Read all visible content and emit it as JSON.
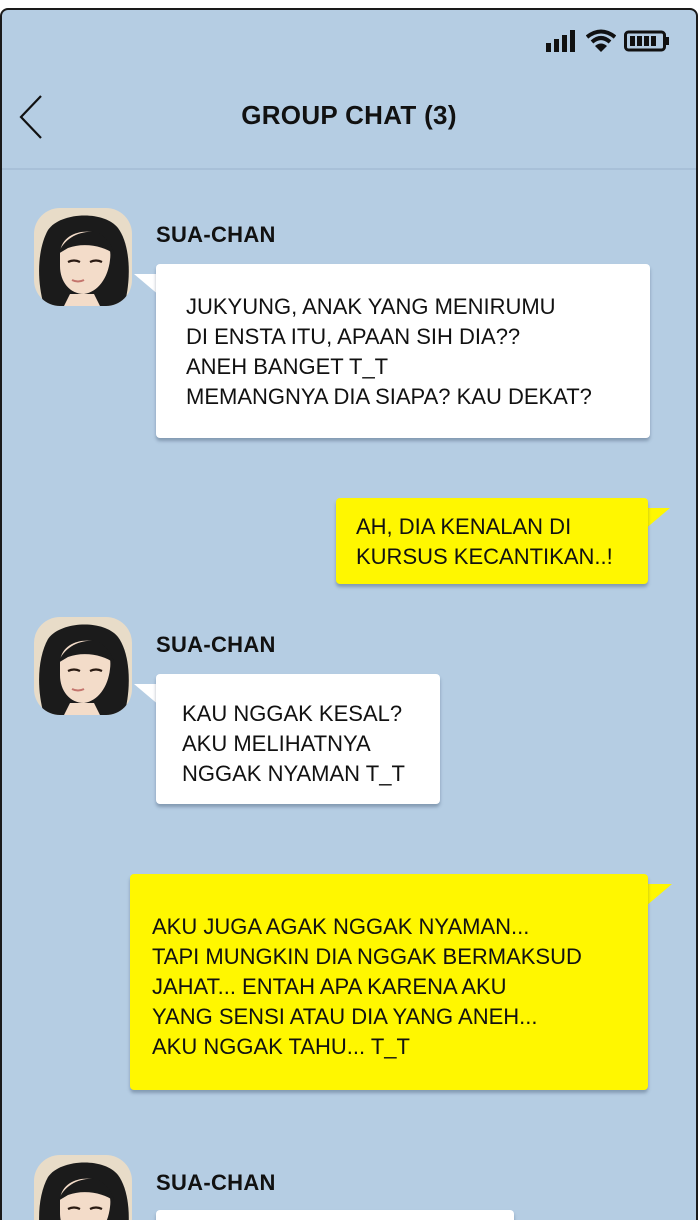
{
  "header": {
    "title": "GROUP CHAT (3)"
  },
  "colors": {
    "background": "#b5cde3",
    "own_bubble": "#fff700",
    "other_bubble": "#ffffff"
  },
  "status_icons": [
    "signal-icon",
    "wifi-icon",
    "battery-icon"
  ],
  "messages": [
    {
      "sender": "SUA-CHAN",
      "text": "JUKYUNG, ANAK YANG MENIRUMU\nDI ENSTA ITU, APAAN SIH DIA??\nANEH BANGET T_T\nMEMANGNYA DIA SIAPA? KAU DEKAT?"
    },
    {
      "sender": "",
      "text": "AH, DIA KENALAN DI\nKURSUS KECANTIKAN..!"
    },
    {
      "sender": "SUA-CHAN",
      "text": "KAU NGGAK KESAL?\nAKU MELIHATNYA\nNGGAK NYAMAN T_T"
    },
    {
      "sender": "",
      "text": "AKU JUGA AGAK NGGAK NYAMAN...\nTAPI MUNGKIN DIA NGGAK BERMAKSUD\nJAHAT... ENTAH APA KARENA AKU\nYANG SENSI ATAU DIA YANG ANEH...\nAKU NGGAK TAHU... T_T"
    },
    {
      "sender": "SUA-CHAN",
      "text": ""
    }
  ]
}
